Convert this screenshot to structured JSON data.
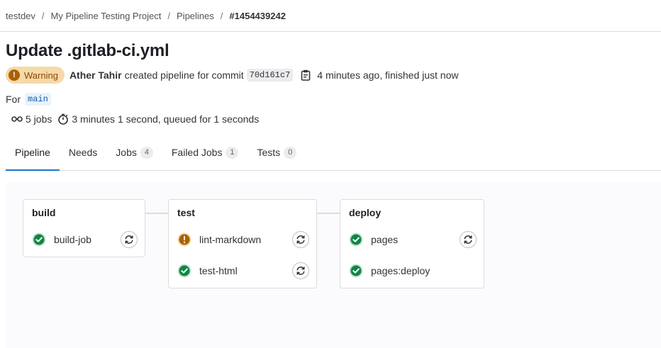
{
  "breadcrumb": [
    "testdev",
    "My Pipeline Testing Project",
    "Pipelines",
    "#1454439242"
  ],
  "title": "Update .gitlab-ci.yml",
  "status": {
    "label": "Warning",
    "icon": "warning-icon",
    "color": "#ab6100"
  },
  "meta": {
    "author": "Ather Tahir",
    "action_text": "created pipeline for commit",
    "commit_sha": "70d161c7",
    "time_text": "4 minutes ago, finished just now"
  },
  "ref": {
    "prefix": "For",
    "branch": "main"
  },
  "stats": {
    "jobs": "5 jobs",
    "duration": "3 minutes 1 second, queued for 1 seconds"
  },
  "tabs": [
    {
      "label": "Pipeline",
      "count": null,
      "active": true
    },
    {
      "label": "Needs",
      "count": null,
      "active": false
    },
    {
      "label": "Jobs",
      "count": "4",
      "active": false
    },
    {
      "label": "Failed Jobs",
      "count": "1",
      "active": false
    },
    {
      "label": "Tests",
      "count": "0",
      "active": false
    }
  ],
  "stages": [
    {
      "name": "build",
      "jobs": [
        {
          "name": "build-job",
          "status": "success"
        }
      ]
    },
    {
      "name": "test",
      "jobs": [
        {
          "name": "lint-markdown",
          "status": "warning"
        },
        {
          "name": "test-html",
          "status": "success"
        }
      ]
    },
    {
      "name": "deploy",
      "jobs": [
        {
          "name": "pages",
          "status": "success"
        },
        {
          "name": "pages:deploy",
          "status": "success"
        }
      ]
    }
  ],
  "colors": {
    "success": "#108548",
    "warning": "#ab6100",
    "accent": "#1f75cb"
  }
}
